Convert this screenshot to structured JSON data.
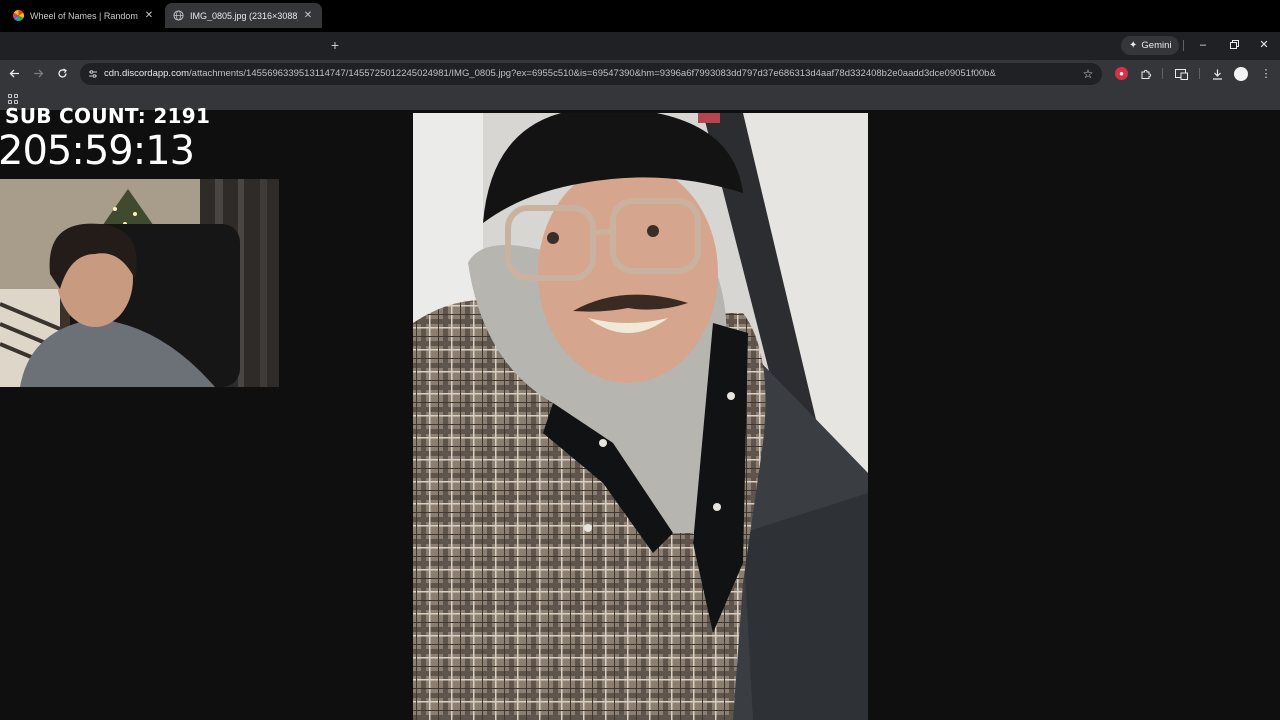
{
  "tabs": [
    {
      "title": "Wheel of Names | Random name picker",
      "active": false
    },
    {
      "title": "IMG_0805.jpg (2316×3088)",
      "active": true
    }
  ],
  "gemini_label": "Gemini",
  "address": {
    "host": "cdn.discordapp.com",
    "path": "/attachments/1455696339513114747/1455725012245024981/IMG_0805.jpg?ex=6955c510&is=69547390&hm=9396a6f7993083dd797d37e686313d4aaf78d332408b2e0aadd3dce09051f00b&"
  },
  "overlay": {
    "sub_count": "SUB COUNT: 2191",
    "timer": "205:59:13"
  },
  "icons": {
    "back": "back-arrow-icon",
    "forward": "forward-arrow-icon",
    "reload": "reload-icon",
    "site_info": "tune-icon",
    "bookmark": "star-icon",
    "extensions": "puzzle-icon",
    "downloads": "download-icon"
  },
  "colors": {
    "tabstrip": "#202124",
    "toolbar": "#35363a",
    "page_bg": "#0f0f0f",
    "extension_red": "#d93048"
  }
}
